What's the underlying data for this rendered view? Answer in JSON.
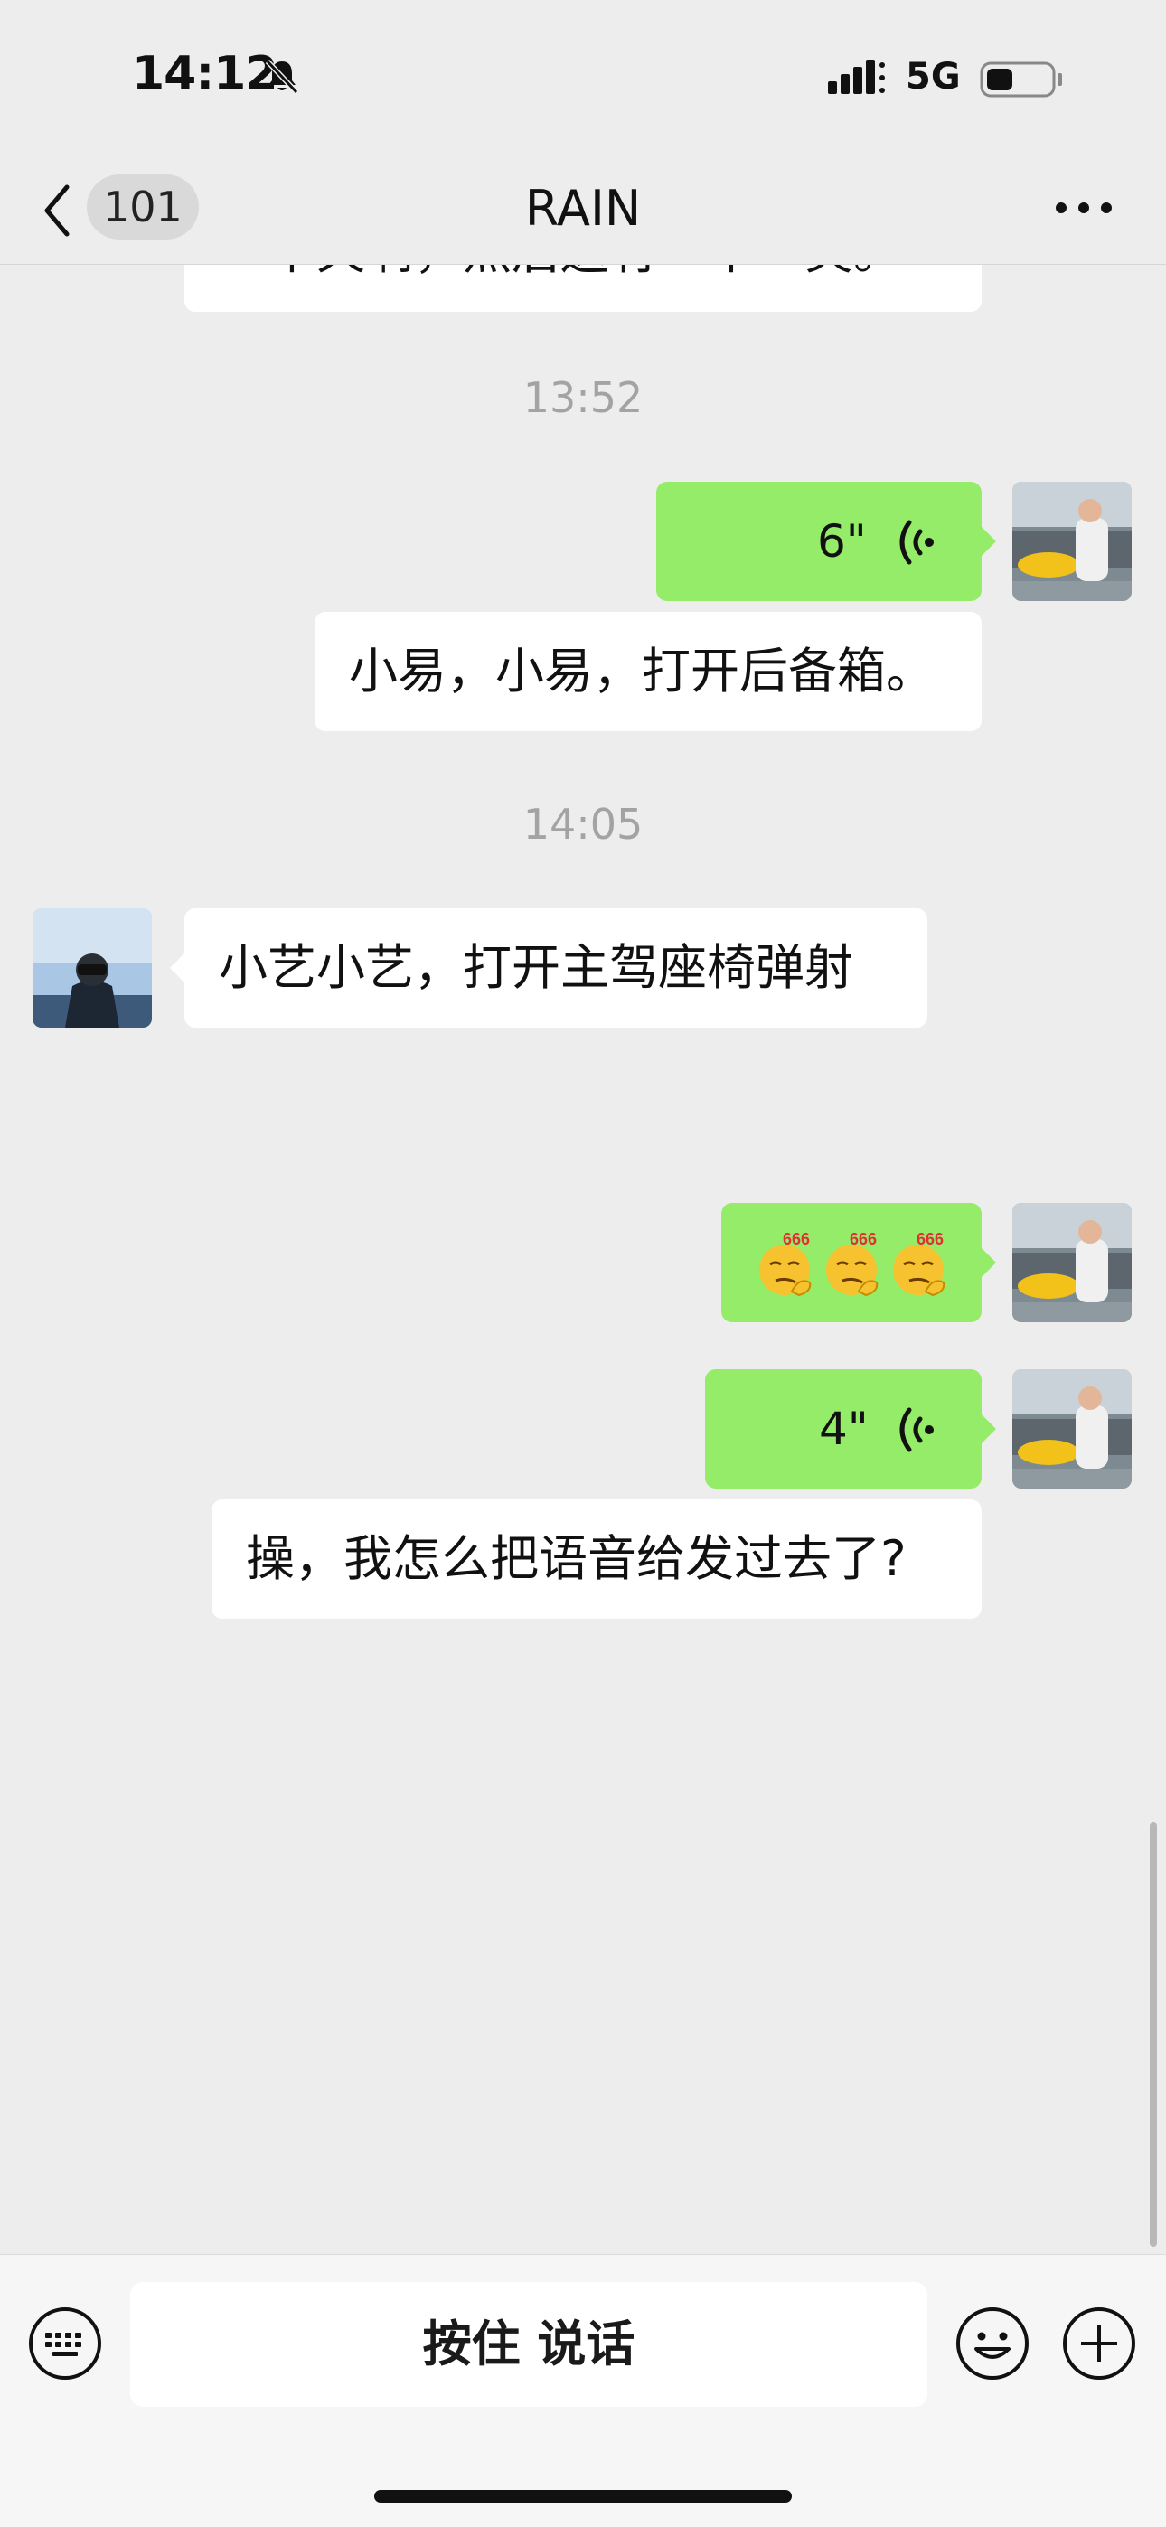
{
  "status_bar": {
    "time": "14:12",
    "network": "5G",
    "icons": [
      "bell-muted-icon",
      "signal-icon",
      "battery-icon"
    ]
  },
  "nav": {
    "back_icon": "chevron-left-icon",
    "unread_count": "101",
    "title": "RAIN",
    "more_icon": "more-horizontal-icon"
  },
  "messages": [
    {
      "type": "text",
      "side": "self",
      "text": "一个天啊，然后送有一个一笑。",
      "partially_visible": true
    },
    {
      "type": "timestamp",
      "text": "13:52"
    },
    {
      "type": "voice",
      "side": "self",
      "duration": "6\""
    },
    {
      "type": "text",
      "side": "self",
      "text": "小易，小易，打开后备箱。"
    },
    {
      "type": "timestamp",
      "text": "14:05"
    },
    {
      "type": "text",
      "side": "other",
      "text": "小艺小艺，打开主驾座椅弹射"
    },
    {
      "type": "emoji",
      "side": "self",
      "emoji_name": "666-smirk-emoji",
      "count": 3,
      "label": "666"
    },
    {
      "type": "voice",
      "side": "self",
      "duration": "4\""
    },
    {
      "type": "text",
      "side": "self",
      "text": "操，我怎么把语音给发过去了?"
    }
  ],
  "input_bar": {
    "keyboard_icon": "keyboard-icon",
    "hold_to_talk_label": "按住 说话",
    "emoji_icon": "smiley-icon",
    "plus_icon": "plus-circle-icon"
  },
  "colors": {
    "background": "#ededed",
    "self_bubble": "#95ec69",
    "other_bubble": "#ffffff",
    "timestamp": "#a3a3a3"
  }
}
